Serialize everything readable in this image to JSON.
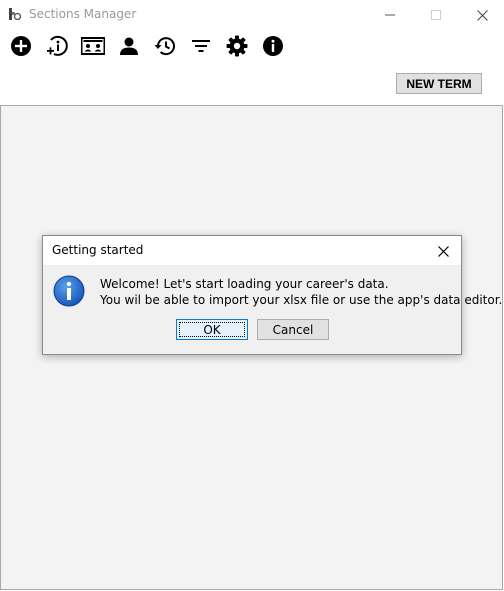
{
  "window": {
    "title": "Sections Manager"
  },
  "toolbar": {
    "tools": [
      {
        "icon": "add-circle-icon"
      },
      {
        "icon": "info-add-icon"
      },
      {
        "icon": "id-card-icon"
      },
      {
        "icon": "person-icon"
      },
      {
        "icon": "history-icon"
      },
      {
        "icon": "filter-icon"
      },
      {
        "icon": "gear-icon"
      },
      {
        "icon": "info-icon"
      }
    ],
    "new_term_label": "NEW TERM"
  },
  "dialog": {
    "title": "Getting started",
    "message_line1": "Welcome! Let's start loading your career's data.",
    "message_line2": "You wil be able to import your xlsx file or use the app's data editor.",
    "ok_label": "OK",
    "cancel_label": "Cancel"
  },
  "colors": {
    "content_bg": "#f3f3f3",
    "dialog_bg": "#f0f0f0",
    "focus_border": "#0078d7",
    "info_blue": "#1c64c8"
  }
}
